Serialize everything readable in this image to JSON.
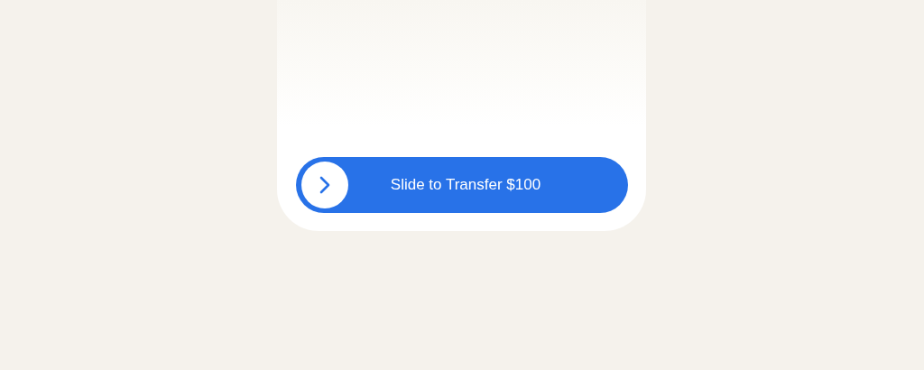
{
  "slider": {
    "label": "Slide to Transfer $100",
    "level": 0
  }
}
